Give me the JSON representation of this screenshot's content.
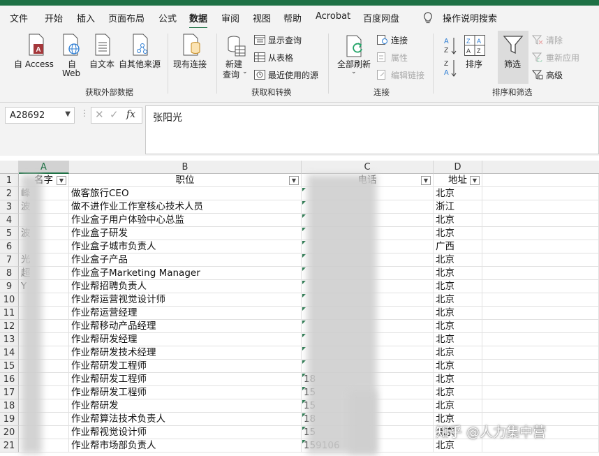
{
  "tabs": [
    "文件",
    "开始",
    "插入",
    "页面布局",
    "公式",
    "数据",
    "审阅",
    "视图",
    "帮助",
    "Acrobat",
    "百度网盘"
  ],
  "active_tab": "数据",
  "tell_me": "操作说明搜索",
  "ribbon": {
    "get_external": {
      "access": "自 Access",
      "web_1": "自",
      "web_2": "Web",
      "text": "自文本",
      "other": "自其他来源",
      "existing": "现有连接",
      "group": "获取外部数据"
    },
    "transform": {
      "new_query_1": "新建",
      "new_query_2": "查询",
      "show_queries": "显示查询",
      "from_table": "从表格",
      "recent_sources": "最近使用的源",
      "group": "获取和转换"
    },
    "connections": {
      "refresh_all": "全部刷新",
      "connections": "连接",
      "properties": "属性",
      "edit_links": "编辑链接",
      "group": "连接"
    },
    "sort_filter": {
      "sort": "排序",
      "filter": "筛选",
      "clear": "清除",
      "reapply": "重新应用",
      "advanced": "高级",
      "group": "排序和筛选"
    }
  },
  "formula_bar": {
    "name_box": "A28692",
    "fx": "fx",
    "value": "张阳光"
  },
  "columns": [
    "A",
    "B",
    "C",
    "D"
  ],
  "rows": [
    1,
    2,
    3,
    4,
    5,
    6,
    7,
    8,
    9,
    10,
    11,
    12,
    13,
    14,
    15,
    16,
    17,
    18,
    19,
    20,
    21
  ],
  "header_row": {
    "a": "名字",
    "b": "职位",
    "c": "电话",
    "d": "地址"
  },
  "data_rows": [
    {
      "a": "峰",
      "b": "做客旅行CEO",
      "c": "",
      "d": "北京"
    },
    {
      "a": "波",
      "b": "做不进作业工作室核心技术人员",
      "c": "",
      "d": "浙江"
    },
    {
      "a": "",
      "b": "作业盒子用户体验中心总监",
      "c": "",
      "d": "北京"
    },
    {
      "a": "波",
      "b": "作业盒子研发",
      "c": "",
      "d": "北京"
    },
    {
      "a": "",
      "b": "作业盒子城市负责人",
      "c": "",
      "d": "广西"
    },
    {
      "a": "光",
      "b": "作业盒子产品",
      "c": "",
      "d": "北京"
    },
    {
      "a": "超",
      "b": "作业盒子Marketing Manager",
      "c": "",
      "d": "北京"
    },
    {
      "a": "Y",
      "b": "作业帮招聘负责人",
      "c": "",
      "d": "北京"
    },
    {
      "a": "",
      "b": "作业帮运营视觉设计师",
      "c": "",
      "d": "北京"
    },
    {
      "a": "",
      "b": "作业帮运营经理",
      "c": "",
      "d": "北京"
    },
    {
      "a": "",
      "b": "作业帮移动产品经理",
      "c": "",
      "d": "北京"
    },
    {
      "a": "",
      "b": "作业帮研发经理",
      "c": "",
      "d": "北京"
    },
    {
      "a": "",
      "b": "作业帮研发技术经理",
      "c": "",
      "d": "北京"
    },
    {
      "a": "",
      "b": "作业帮研发工程师",
      "c": "",
      "d": "北京"
    },
    {
      "a": "",
      "b": "作业帮研发工程师",
      "c": "18",
      "d": "北京"
    },
    {
      "a": "",
      "b": "作业帮研发工程师",
      "c": "15",
      "d": "北京"
    },
    {
      "a": "",
      "b": "作业帮研发",
      "c": "15",
      "d": "北京"
    },
    {
      "a": "",
      "b": "作业帮算法技术负责人",
      "c": "18",
      "d": "北京"
    },
    {
      "a": "",
      "b": "作业帮视觉设计师",
      "c": "15",
      "d": "北京"
    },
    {
      "a": "",
      "b": "作业帮市场部负责人",
      "c": "159106",
      "d": "北京"
    }
  ],
  "watermark": "知乎 @人力集中营",
  "colors": {
    "excel_green": "#1e7145"
  }
}
